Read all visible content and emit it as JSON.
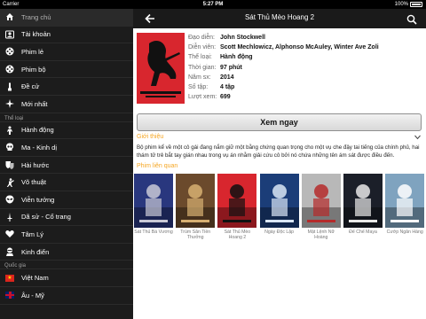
{
  "status_bar": {
    "carrier": "Carrier",
    "time": "5:27 PM",
    "battery": "100%"
  },
  "sidebar": {
    "items": [
      {
        "label": "Trang chủ",
        "icon": "home-icon",
        "active": true
      },
      {
        "label": "Tài khoản",
        "icon": "user-icon"
      },
      {
        "label": "Phim lẻ",
        "icon": "film-reel-icon"
      },
      {
        "label": "Phim bộ",
        "icon": "film-reel-icon"
      },
      {
        "label": "Đề cử",
        "icon": "thumbs-up-icon"
      },
      {
        "label": "Mới nhất",
        "icon": "sparkle-icon"
      }
    ],
    "genre_header": "Thể loại",
    "genres": [
      {
        "label": "Hành động",
        "icon": "action-icon"
      },
      {
        "label": "Ma - Kinh dị",
        "icon": "skull-icon"
      },
      {
        "label": "Hài hước",
        "icon": "mask-icon"
      },
      {
        "label": "Võ thuật",
        "icon": "martial-arts-icon"
      },
      {
        "label": "Viễn tưởng",
        "icon": "alien-icon"
      },
      {
        "label": "Dã sử - Cổ trang",
        "icon": "sword-icon"
      },
      {
        "label": "Tâm Lý",
        "icon": "heart-icon"
      },
      {
        "label": "Kinh điển",
        "icon": "ninja-icon"
      }
    ],
    "country_header": "Quốc gia",
    "countries": [
      {
        "label": "Việt Nam",
        "icon": "vietnam-flag-icon"
      },
      {
        "label": "Âu - Mỹ",
        "icon": "uk-flag-icon"
      }
    ]
  },
  "header": {
    "title": "Sát Thủ Mèo Hoang 2"
  },
  "movie": {
    "director_label": "Đạo diễn:",
    "director": "John Stockwell",
    "cast_label": "Diễn viên:",
    "cast": "Scott Mechlowicz,  Alphonso McAuley,  Winter Ave Zoli",
    "genre_label": "Thể loại:",
    "genre": "Hành động",
    "duration_label": "Thời gian:",
    "duration": "97 phút",
    "year_label": "Năm sx:",
    "year": "2014",
    "episodes_label": "Số tập:",
    "episodes": "4 tập",
    "views_label": "Lượt xem:",
    "views": "699"
  },
  "watch_button": "Xem ngay",
  "intro_title": "Giới thiệu",
  "description": "Bộ phim kể về một cô gái đang nắm giữ một bằng chứng quan trọng cho một vụ che đậy tai tiếng của chính phủ, hai thám tử trẻ bắt tay gián nhau trong vụ án nhằm giải cứu cô bởi nó chứa những tên ám sát được điều đến.",
  "related_title": "Phim liên quan",
  "related": [
    {
      "title": "Sát Thủ Bá Vương",
      "bg": "#29377e",
      "accent": "#c9c9d6"
    },
    {
      "title": "Trùm Săn Tiền Thưởng",
      "bg": "#6b4a2c",
      "accent": "#d7b072"
    },
    {
      "title": "Sát Thủ Mèo Hoang 2",
      "bg": "#d8262e",
      "accent": "#111111"
    },
    {
      "title": "Ngày Độc Lập",
      "bg": "#1b3d78",
      "accent": "#d9e6f5"
    },
    {
      "title": "Mật Lệnh Nữ Hoàng",
      "bg": "#b8b8b8",
      "accent": "#b52a2a"
    },
    {
      "title": "Đế Chế Maya",
      "bg": "#1b1f29",
      "accent": "#e8e8e8"
    },
    {
      "title": "Cướp Ngân Hàng",
      "bg": "#7fa3bf",
      "accent": "#ffffff"
    }
  ]
}
